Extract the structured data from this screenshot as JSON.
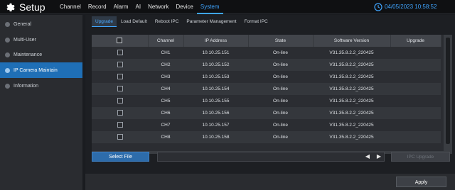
{
  "app": {
    "title": "Setup",
    "datetime": "04/05/2023 10:58:52"
  },
  "topnav": [
    "Channel",
    "Record",
    "Alarm",
    "AI",
    "Network",
    "Device",
    "System"
  ],
  "sidebar": {
    "items": [
      "General",
      "Multi-User",
      "Maintenance",
      "IP Camera Maintain",
      "Information"
    ]
  },
  "subtabs": [
    "Upgrade",
    "Load Default",
    "Reboot IPC",
    "Parameter Management",
    "Format IPC"
  ],
  "table": {
    "headers": {
      "channel": "Channel",
      "ip": "IP Address",
      "state": "State",
      "version": "Software Version",
      "upgrade": "Upgrade"
    },
    "rows": [
      {
        "channel": "CH1",
        "ip": "10.10.25.151",
        "state": "On-line",
        "version": "V31.35.8.2.2_220425",
        "upgrade": ""
      },
      {
        "channel": "CH2",
        "ip": "10.10.25.152",
        "state": "On-line",
        "version": "V31.35.8.2.2_220425",
        "upgrade": ""
      },
      {
        "channel": "CH3",
        "ip": "10.10.25.153",
        "state": "On-line",
        "version": "V31.35.8.2.2_220425",
        "upgrade": ""
      },
      {
        "channel": "CH4",
        "ip": "10.10.25.154",
        "state": "On-line",
        "version": "V31.35.8.2.2_220425",
        "upgrade": ""
      },
      {
        "channel": "CH5",
        "ip": "10.10.25.155",
        "state": "On-line",
        "version": "V31.35.8.2.2_220425",
        "upgrade": ""
      },
      {
        "channel": "CH6",
        "ip": "10.10.25.156",
        "state": "On-line",
        "version": "V31.35.8.2.2_220425",
        "upgrade": ""
      },
      {
        "channel": "CH7",
        "ip": "10.10.25.157",
        "state": "On-line",
        "version": "V31.35.8.2.2_220425",
        "upgrade": ""
      },
      {
        "channel": "CH8",
        "ip": "10.10.25.158",
        "state": "On-line",
        "version": "V31.35.8.2.2_220425",
        "upgrade": ""
      }
    ]
  },
  "controls": {
    "select_file": "Select File",
    "file_path": "",
    "ipc_upgrade": "IPC Upgrade",
    "apply": "Apply"
  },
  "icons": {
    "app": "gear-icon",
    "clock": "clock-icon",
    "prev": "triangle-left-icon",
    "next": "triangle-right-icon"
  },
  "colors": {
    "accent": "#3fa5ff",
    "sidebar_active": "#1f6fb6",
    "button": "#2d6cab"
  }
}
